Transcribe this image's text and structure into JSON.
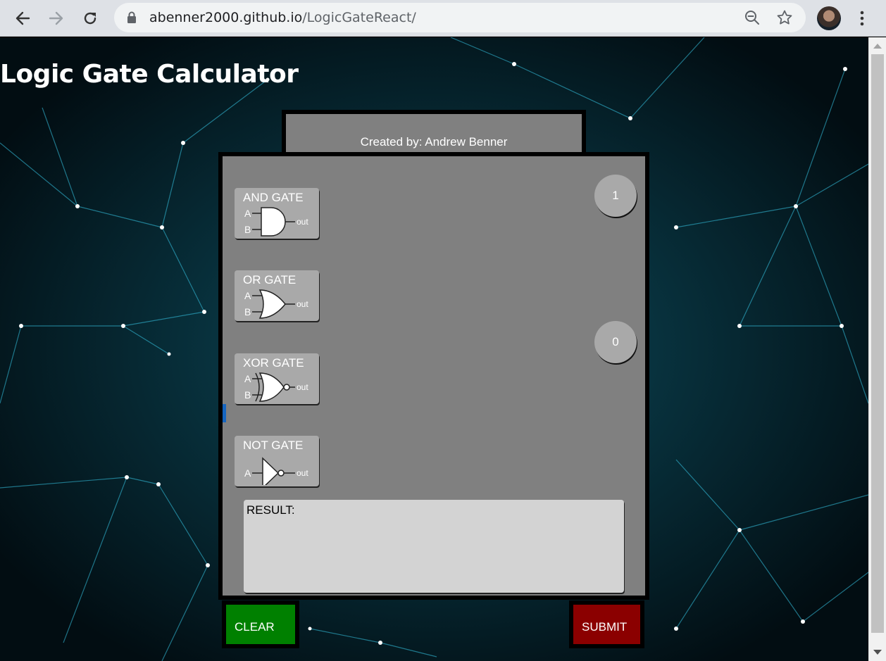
{
  "browser": {
    "url_host": "abenner2000.github.io",
    "url_path": "/LogicGateReact/"
  },
  "page": {
    "title": "Logic Gate Calculator",
    "credit": "Created by: Andrew Benner"
  },
  "gates": [
    {
      "label": "AND GATE",
      "icon": "and-gate-icon"
    },
    {
      "label": "OR GATE",
      "icon": "or-gate-icon"
    },
    {
      "label": "XOR GATE",
      "icon": "xor-gate-icon"
    },
    {
      "label": "NOT GATE",
      "icon": "not-gate-icon"
    }
  ],
  "inputs": {
    "top_value": "1",
    "bottom_value": "0"
  },
  "result": {
    "label": "RESULT:"
  },
  "buttons": {
    "clear": "CLEAR",
    "submit": "SUBMIT"
  },
  "colors": {
    "panel": "#808080",
    "clear": "#008000",
    "submit": "#8b0000"
  }
}
